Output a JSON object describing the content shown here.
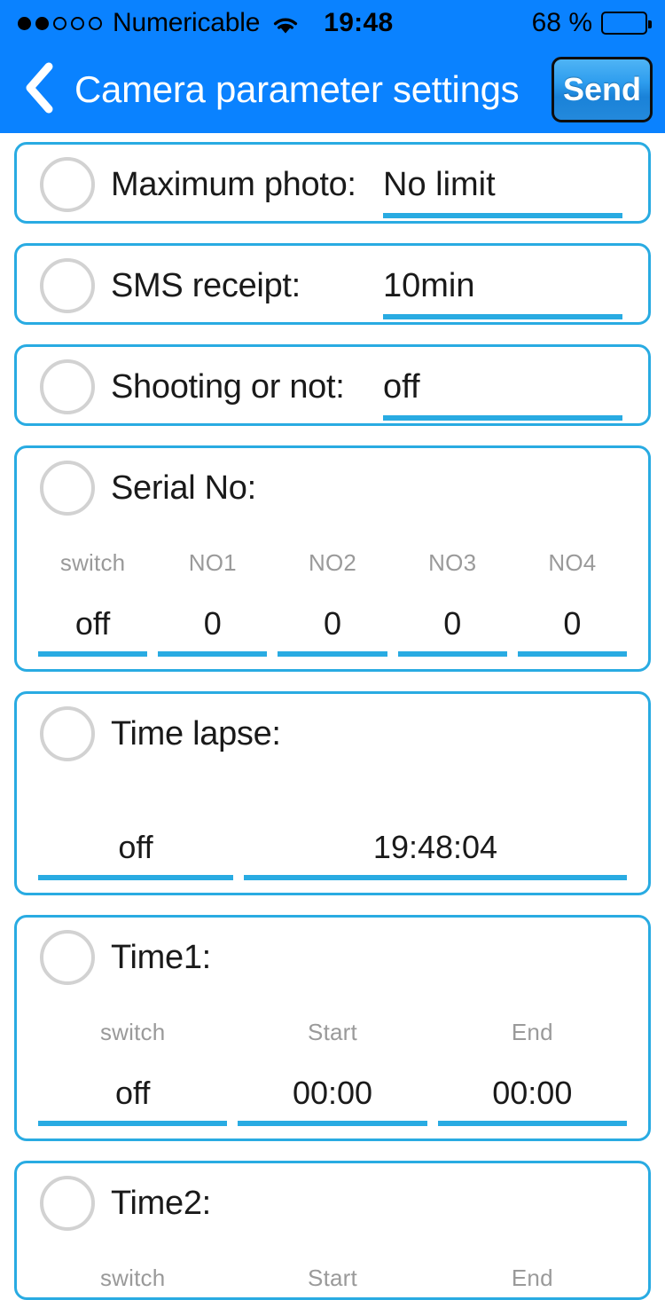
{
  "status_bar": {
    "signal_dots": [
      true,
      true,
      false,
      false,
      false
    ],
    "carrier": "Numericable",
    "wifi_icon": "wifi-icon",
    "time": "19:48",
    "battery_percent": "68 %",
    "battery_level": 68
  },
  "nav": {
    "back_icon": "chevron-left-icon",
    "title": "Camera parameter settings",
    "send_label": "Send"
  },
  "colors": {
    "header_blue": "#0A82FF",
    "border_blue": "#29ABE2",
    "underline_blue": "#29ABE2",
    "radio_gray": "#d2d2d2",
    "col_head_gray": "#9a9a9a"
  },
  "sections": [
    {
      "type": "simple",
      "label": "Maximum photo:",
      "value": "No limit"
    },
    {
      "type": "simple",
      "label": "SMS receipt:",
      "value": "10min"
    },
    {
      "type": "simple",
      "label": "Shooting or not:",
      "value": "off"
    },
    {
      "type": "columns",
      "label": "Serial No:",
      "headers": [
        "switch",
        "NO1",
        "NO2",
        "NO3",
        "NO4"
      ],
      "values": [
        "off",
        "0",
        "0",
        "0",
        "0"
      ]
    },
    {
      "type": "lapse",
      "label": "Time lapse:",
      "headers": [
        "",
        ""
      ],
      "values": [
        "off",
        "19:48:04"
      ]
    },
    {
      "type": "columns",
      "label": "Time1:",
      "headers": [
        "switch",
        "Start",
        "End"
      ],
      "values": [
        "off",
        "00:00",
        "00:00"
      ]
    },
    {
      "type": "columns_partial",
      "label": "Time2:",
      "headers": [
        "switch",
        "Start",
        "End"
      ],
      "values": [
        "",
        "",
        ""
      ]
    }
  ]
}
